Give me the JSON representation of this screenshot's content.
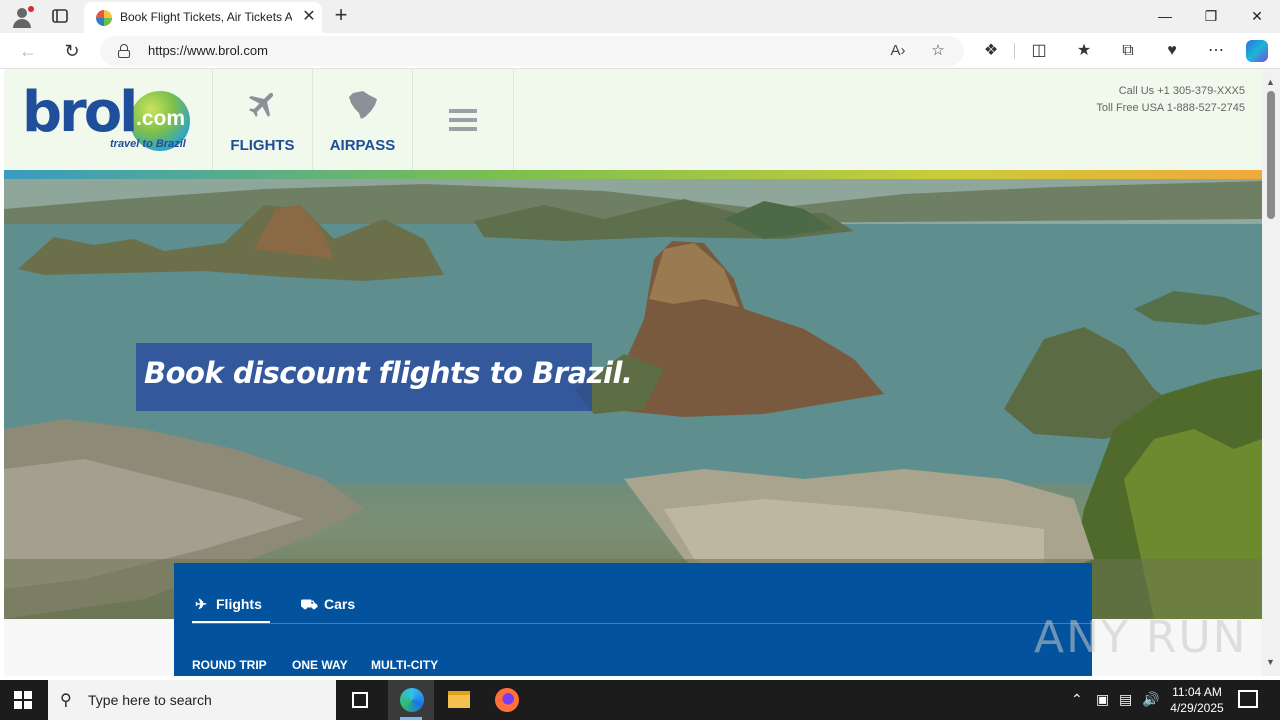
{
  "browser": {
    "tab_title": "Book Flight Tickets, Air Tickets Ai",
    "url": "https://www.brol.com",
    "new_tab_symbol": "+",
    "tab_close_symbol": "✕",
    "window": {
      "minimize": "—",
      "restore": "❐",
      "close": "✕"
    }
  },
  "site": {
    "logo": {
      "word": "brol",
      "badge": ".com",
      "tagline": "travel to Brazil"
    },
    "nav": [
      {
        "label": "FLIGHTS",
        "icon": "airplane-icon"
      },
      {
        "label": "AIRPASS",
        "icon": "brazil-map-icon"
      }
    ],
    "menu_icon": "hamburger-menu-icon",
    "contact": {
      "call_us": "Call Us +1 305-379-XXX5",
      "toll_free": "Toll Free USA 1-888-527-2745"
    },
    "hero": {
      "headline": "Book discount flights to Brazil."
    },
    "search_panel": {
      "tabs": [
        {
          "label": "Flights",
          "icon": "airplane-icon",
          "active": true
        },
        {
          "label": "Cars",
          "icon": "car-icon",
          "active": false
        }
      ],
      "trip_types": [
        "ROUND TRIP",
        "ONE WAY",
        "MULTI-CITY"
      ]
    },
    "brand_colors": {
      "primary_blue": "#1f4e9a",
      "panel_blue": "#02529e",
      "header_bg": "#f1f8ec"
    }
  },
  "watermark": "ANY RUN",
  "taskbar": {
    "search_placeholder": "Type here to search",
    "time": "11:04 AM",
    "date": "4/29/2025"
  }
}
